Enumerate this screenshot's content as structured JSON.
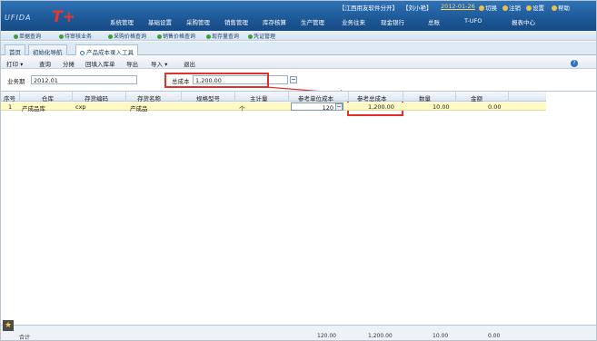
{
  "logo": {
    "brand_text": "UFIDA",
    "product": "T+"
  },
  "topbar": {
    "company": "【江西用友软件分开】",
    "user": "【刘小艳】",
    "date": "2012-01-26",
    "switch_label": "切换",
    "logout_label": "注销",
    "settings_label": "设置",
    "help_label": "帮助"
  },
  "mainmenu": [
    "系统管理",
    "基础设置",
    "采购管理",
    "销售管理",
    "库存核算",
    "生产管理",
    "业务往来",
    "现金银行",
    "总账",
    "T-UFO",
    "报表中心"
  ],
  "quicklinks": [
    "单据查询",
    "待审核业务",
    "采购价格查询",
    "销售价格查询",
    "现存量查询",
    "凭证管理"
  ],
  "tabs": [
    "首页",
    "初始化导航",
    "产品成本录入工具"
  ],
  "toolbar": [
    "打印",
    "查询",
    "分摊",
    "回填入库单",
    "导出",
    "导入",
    "退出"
  ],
  "filter": {
    "period_label": "业务期",
    "period_value": "2012.01",
    "total_cost_label": "总成本",
    "total_cost_value": "1,200.00"
  },
  "columns": [
    "序号",
    "仓库",
    "存货编码",
    "存货名称",
    "规格型号",
    "主计量",
    "参考单位成本",
    "参考总成本",
    "数量",
    "金额"
  ],
  "rows": [
    {
      "seq": "1",
      "warehouse": "产成品库",
      "code": "cxp",
      "name": "产成品",
      "spec": "",
      "unit": "个",
      "unit_cost": "120",
      "total_cost": "1,200.00",
      "qty": "10.00",
      "amount": "0.00"
    }
  ],
  "footer": {
    "unit_cost_sum": "120.00",
    "total_cost_sum": "1,200.00",
    "qty_sum": "10.00",
    "amount_sum": "0.00",
    "left_label": "合计"
  },
  "colors": {
    "banner": "#1e5a99",
    "annotation": "#e0322b",
    "row_highlight": "#fff9c4"
  }
}
